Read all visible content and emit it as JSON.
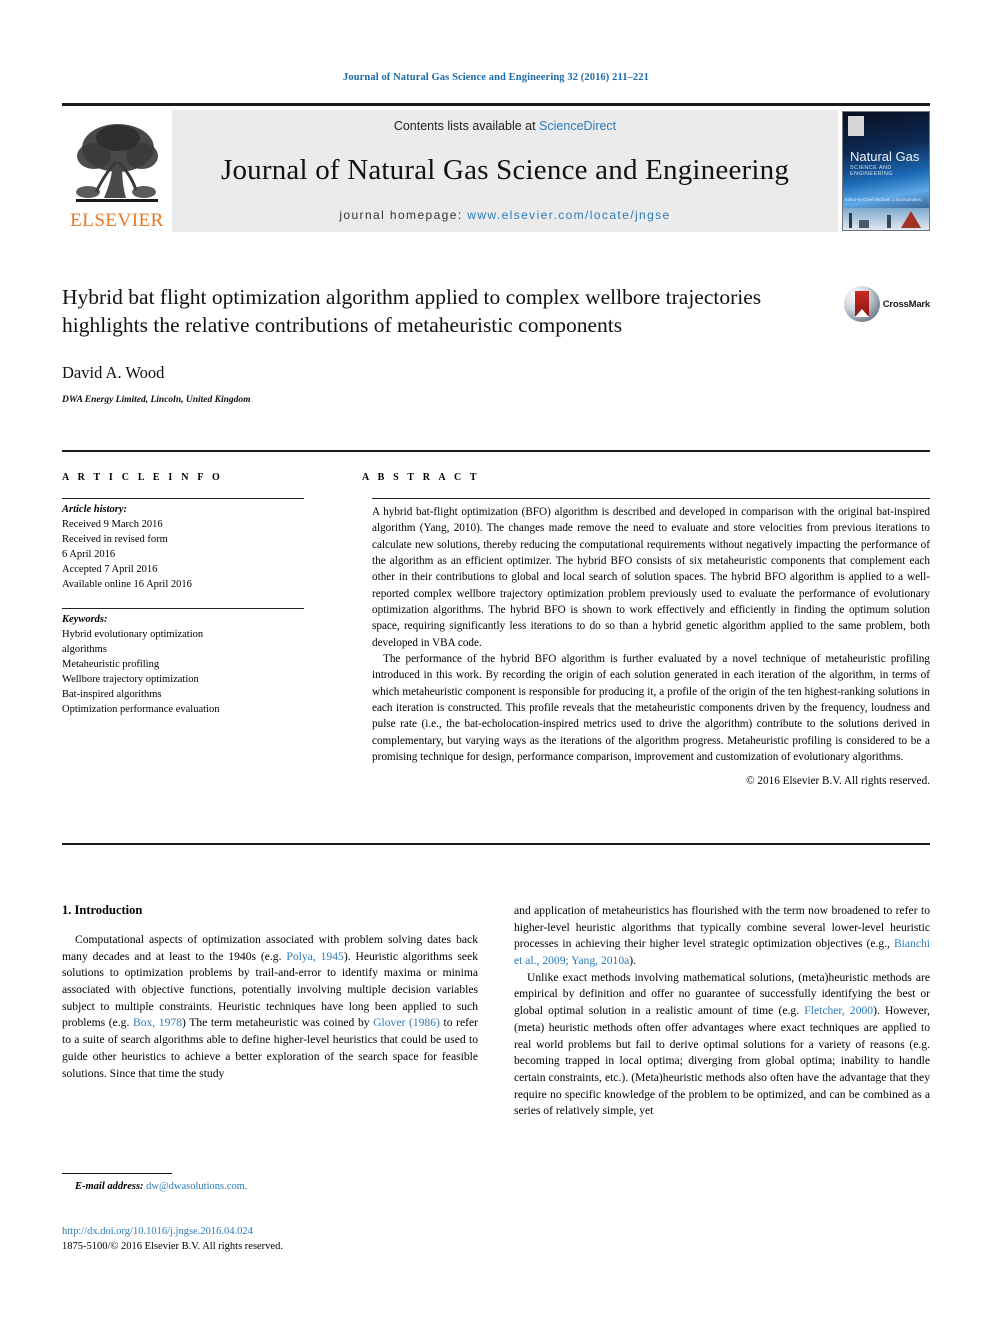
{
  "running_head": "Journal of Natural Gas Science and Engineering 32 (2016) 211–221",
  "masthead": {
    "contents_prefix": "Contents lists available at ",
    "sciencedirect": "ScienceDirect",
    "journal_title": "Journal of Natural Gas Science and Engineering",
    "homepage_prefix": "journal homepage: ",
    "homepage_url": "www.elsevier.com/locate/jngse",
    "publisher": "ELSEVIER",
    "cover": {
      "title": "Natural Gas",
      "subtitle": "SCIENCE AND ENGINEERING",
      "editors": "Editor-in-Chief\nMichael J. Economides"
    }
  },
  "article": {
    "title": "Hybrid bat flight optimization algorithm applied to complex wellbore trajectories highlights the relative contributions of metaheuristic components",
    "author": "David A. Wood",
    "affiliation": "DWA Energy Limited, Lincoln, United Kingdom",
    "crossmark_label": "CrossMark"
  },
  "headings": {
    "article_info": "A R T I C L E   I N F O",
    "abstract": "A B S T R A C T"
  },
  "article_info": {
    "history_label": "Article history:",
    "history": [
      "Received 9 March 2016",
      "Received in revised form",
      "6 April 2016",
      "Accepted 7 April 2016",
      "Available online 16 April 2016"
    ],
    "keywords_label": "Keywords:",
    "keywords": [
      "Hybrid evolutionary optimization",
      "algorithms",
      "Metaheuristic profiling",
      "Wellbore trajectory optimization",
      "Bat-inspired algorithms",
      "Optimization performance evaluation"
    ]
  },
  "abstract": {
    "paragraph_1": "A hybrid bat-flight optimization (BFO) algorithm is described and developed in comparison with the original bat-inspired algorithm (Yang, 2010). The changes made remove the need to evaluate and store velocities from previous iterations to calculate new solutions, thereby reducing the computational requirements without negatively impacting the performance of the algorithm as an efficient optimizer. The hybrid BFO consists of six metaheuristic components that complement each other in their contributions to global and local search of solution spaces. The hybrid BFO algorithm is applied to a well-reported complex wellbore trajectory optimization problem previously used to evaluate the performance of evolutionary optimization algorithms. The hybrid BFO is shown to work effectively and efficiently in finding the optimum solution space, requiring significantly less iterations to do so than a hybrid genetic algorithm applied to the same problem, both developed in VBA code.",
    "paragraph_2": "The performance of the hybrid BFO algorithm is further evaluated by a novel technique of metaheuristic profiling introduced in this work. By recording the origin of each solution generated in each iteration of the algorithm, in terms of which metaheuristic component is responsible for producing it, a profile of the origin of the ten highest-ranking solutions in each iteration is constructed. This profile reveals that the metaheuristic components driven by the frequency, loudness and pulse rate (i.e., the bat-echolocation-inspired metrics used to drive the algorithm) contribute to the solutions derived in complementary, but varying ways as the iterations of the algorithm progress. Metaheuristic profiling is considered to be a promising technique for design, performance comparison, improvement and customization of evolutionary algorithms.",
    "copyright": "© 2016 Elsevier B.V. All rights reserved."
  },
  "body": {
    "section_number_title": "1. Introduction",
    "left_paragraph_1_a": "Computational aspects of optimization associated with problem solving dates back many decades and at least to the 1940s (e.g. ",
    "left_ref_1": "Polya, 1945",
    "left_paragraph_1_b": "). Heuristic algorithms seek solutions to optimization problems by trail-and-error to identify maxima or minima associated with objective functions, potentially involving multiple decision variables subject to multiple constraints. Heuristic techniques have long been applied to such problems (e.g. ",
    "left_ref_2": "Box, 1978",
    "left_paragraph_1_c": ") The term metaheuristic was coined by ",
    "left_ref_3": "Glover (1986)",
    "left_paragraph_1_d": " to refer to a suite of search algorithms able to define higher-level heuristics that could be used to guide other heuristics to achieve a better exploration of the search space for feasible solutions. Since that time the study ",
    "right_paragraph_1_a": "and application of metaheuristics has flourished with the term now broadened to refer to higher-level heuristic algorithms that typically combine several lower-level heuristic processes in achieving their higher level strategic optimization objectives (e.g., ",
    "right_ref_1": "Bianchi et al., 2009; Yang, 2010a",
    "right_paragraph_1_b": ").",
    "right_paragraph_2_a": "Unlike exact methods involving mathematical solutions, (meta)heuristic methods are empirical by definition and offer no guarantee of successfully identifying the best or global optimal solution in a realistic amount of time (e.g. ",
    "right_ref_2": "Fletcher, 2000",
    "right_paragraph_2_b": "). However, (meta) heuristic methods often offer advantages where exact techniques are applied to real world problems but fail to derive optimal solutions for a variety of reasons (e.g. becoming trapped in local optima; diverging from global optima; inability to handle certain constraints, etc.). (Meta)heuristic methods also often have the advantage that they require no specific knowledge of the problem to be optimized, and can be combined as a series of relatively simple, yet"
  },
  "footnote": {
    "label": "E-mail address:",
    "email": "dw@dwasolutions.com."
  },
  "footer": {
    "doi": "http://dx.doi.org/10.1016/j.jngse.2016.04.024",
    "issn_line": "1875-5100/© 2016 Elsevier B.V. All rights reserved."
  },
  "colors": {
    "link": "#2b7bb9",
    "elsevier_orange": "#E87722",
    "rule": "#1a1a1a"
  }
}
